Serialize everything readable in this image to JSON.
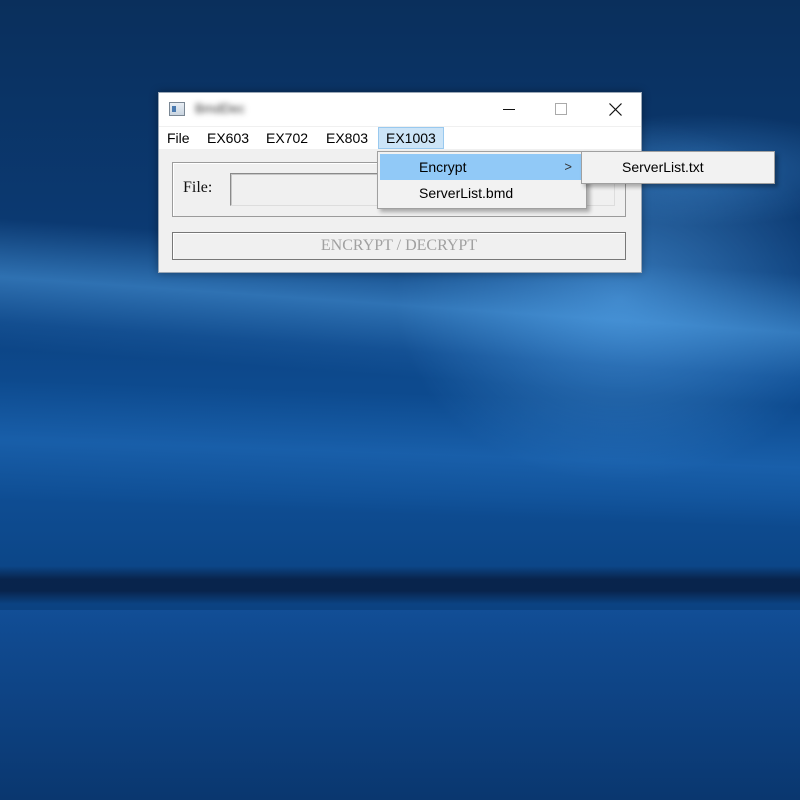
{
  "window": {
    "title": "BmdDec"
  },
  "menubar": {
    "items": [
      "File",
      "EX603",
      "EX702",
      "EX803",
      "EX1003"
    ],
    "active": "EX1003"
  },
  "dropdown": {
    "items": [
      {
        "label": "Encrypt",
        "has_submenu": true,
        "arrow": ">"
      },
      {
        "label": "ServerList.bmd",
        "has_submenu": false
      }
    ]
  },
  "submenu": {
    "items": [
      {
        "label": "ServerList.txt"
      }
    ]
  },
  "form": {
    "file_label": "File:",
    "file_value": ""
  },
  "action_button": {
    "label": "ENCRYPT / DECRYPT",
    "enabled": false
  },
  "colors": {
    "menu_highlight": "#91c9f7",
    "menubar_active": "#cce4f7",
    "desktop": "#0d4a8e"
  }
}
